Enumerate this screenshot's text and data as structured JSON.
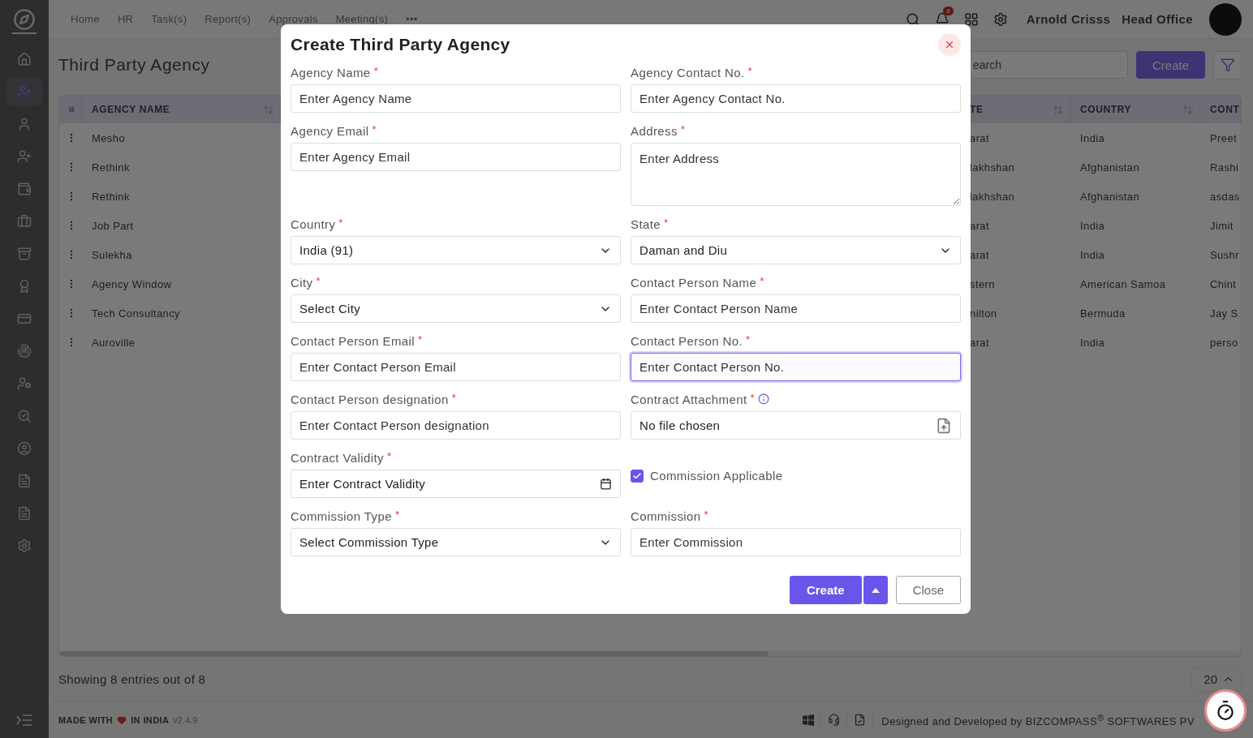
{
  "sidebar": {
    "items": [
      {
        "selected": false
      },
      {
        "selected": true
      },
      {
        "selected": false
      },
      {
        "selected": false
      },
      {
        "selected": false
      },
      {
        "selected": false
      },
      {
        "selected": false
      },
      {
        "selected": false
      },
      {
        "selected": false
      },
      {
        "selected": false
      },
      {
        "selected": false
      },
      {
        "selected": false
      },
      {
        "selected": false
      },
      {
        "selected": false
      },
      {
        "selected": false
      },
      {
        "selected": false
      }
    ]
  },
  "nav": {
    "items": [
      {
        "label": "Home"
      },
      {
        "label": "HR"
      },
      {
        "label": "Task(s)"
      },
      {
        "label": "Report(s)"
      },
      {
        "label": "Approvals"
      },
      {
        "label": "Meeting(s)"
      },
      {
        "label": "•••"
      }
    ]
  },
  "header": {
    "notification_count": "8",
    "user_name": "Arnold Crisss",
    "branch": "Head Office"
  },
  "page": {
    "title": "Third Party Agency",
    "search": {
      "placeholder": "earch"
    },
    "create_button": "Create"
  },
  "table": {
    "columns": [
      "AGENCY NAME",
      "TE",
      "COUNTRY",
      "CONT"
    ],
    "rows": [
      {
        "cells": [
          "Mesho",
          "arat",
          "India",
          "Preet"
        ]
      },
      {
        "cells": [
          "Rethink",
          "lakhshan",
          "Afghanistan",
          "Rashi"
        ]
      },
      {
        "cells": [
          "Rethink",
          "lakhshan",
          "Afghanistan",
          "asdas"
        ]
      },
      {
        "cells": [
          "Job Part",
          "arat",
          "India",
          "Jimit"
        ]
      },
      {
        "cells": [
          "Sulekha",
          "arat",
          "India",
          "Sushr"
        ]
      },
      {
        "cells": [
          "Agency Window",
          "stern",
          "American Samoa",
          "Chint"
        ]
      },
      {
        "cells": [
          "Tech Consultancy",
          "nilton",
          "Bermuda",
          "Jay S"
        ]
      },
      {
        "cells": [
          "Auroville",
          "arat",
          "India",
          "perso"
        ]
      }
    ]
  },
  "pagination": {
    "summary": "Showing 8 entries out of 8",
    "page_size": "20"
  },
  "footer": {
    "made_with": "MADE WITH",
    "in_india": "IN INDIA",
    "version": "v2.4.9",
    "credit": "Designed and Developed by  BIZCOMPASS$^{®}$ SOFTWARES PV"
  },
  "dialog": {
    "title": "Create Third Party Agency",
    "fields": [
      {
        "kind": "text",
        "label": "Agency Name",
        "required_mark": "*",
        "placeholder": "Enter Agency Name",
        "focused": false
      },
      {
        "kind": "text",
        "label": "Agency Contact No.",
        "required_mark": "*",
        "placeholder": "Enter Agency Contact No.",
        "focused": false
      },
      {
        "kind": "text",
        "label": "Agency Email",
        "required_mark": "*",
        "placeholder": "Enter Agency Email",
        "focused": false
      },
      {
        "kind": "textarea",
        "label": "Address",
        "required_mark": "*",
        "placeholder": "Enter Address"
      },
      {
        "kind": "select",
        "label": "Country",
        "required_mark": "*",
        "value": "India (91)"
      },
      {
        "kind": "select",
        "label": "State",
        "required_mark": "*",
        "value": "Daman and Diu"
      },
      {
        "kind": "select",
        "label": "City",
        "required_mark": "*",
        "value": "Select City"
      },
      {
        "kind": "text",
        "label": "Contact Person Name",
        "required_mark": "*",
        "placeholder": "Enter Contact Person Name",
        "focused": false
      },
      {
        "kind": "text",
        "label": "Contact Person Email",
        "required_mark": "*",
        "placeholder": "Enter Contact Person Email",
        "focused": false
      },
      {
        "kind": "text",
        "label": "Contact Person No.",
        "required_mark": "*",
        "placeholder": "Enter Contact Person No.",
        "focused": true
      },
      {
        "kind": "text",
        "label": "Contact Person designation",
        "required_mark": "*",
        "placeholder": "Enter Contact Person designation",
        "focused": false
      },
      {
        "kind": "file",
        "label": "Contract Attachment",
        "required_mark": "*",
        "value": "No file chosen"
      },
      {
        "kind": "date",
        "label": "Contract Validity",
        "required_mark": "*",
        "placeholder": "Enter Contract Validity"
      },
      {
        "kind": "checkbox",
        "label": "Commission Applicable",
        "checked": true
      },
      {
        "kind": "select",
        "label": "Commission Type",
        "required_mark": "*",
        "value": "Select Commission Type"
      },
      {
        "kind": "text",
        "label": "Commission",
        "required_mark": "*",
        "placeholder": "Enter Commission",
        "focused": false
      }
    ],
    "buttons": {
      "create": "Create",
      "close": "Close"
    }
  }
}
